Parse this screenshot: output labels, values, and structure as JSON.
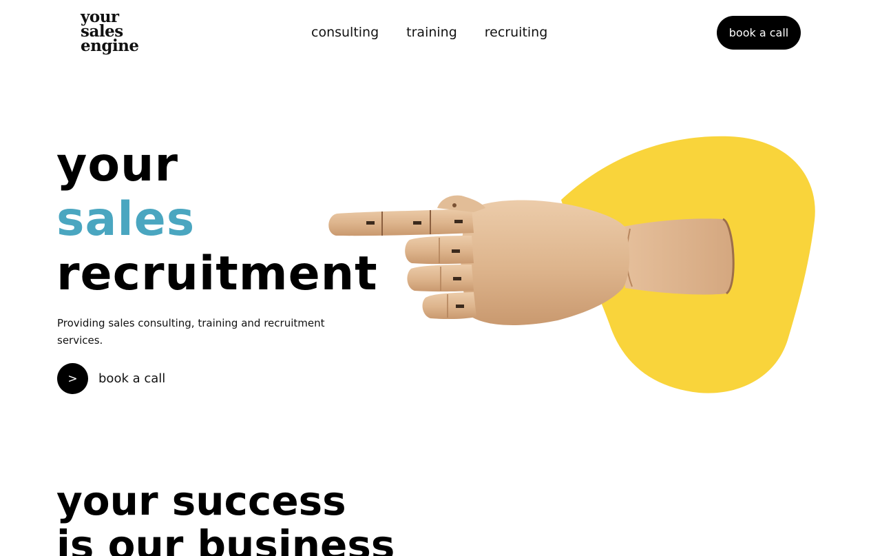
{
  "header": {
    "logo_lines": [
      "your",
      "sales",
      "engine"
    ],
    "nav": [
      "consulting",
      "training",
      "recruiting"
    ],
    "cta_label": "book a call"
  },
  "hero": {
    "title_lines": [
      "your",
      "sales",
      "recruitment"
    ],
    "subtitle": "Providing sales consulting, training and recruitment services.",
    "cta_icon": ">",
    "cta_label": "book a call",
    "image_alt": "wooden mannequin hand pointing left over yellow blob"
  },
  "section": {
    "title_lines": [
      "your success",
      "is our business"
    ]
  },
  "colors": {
    "accent": "#4aa6c0",
    "blob": "#f9d43b",
    "text": "#000000"
  }
}
